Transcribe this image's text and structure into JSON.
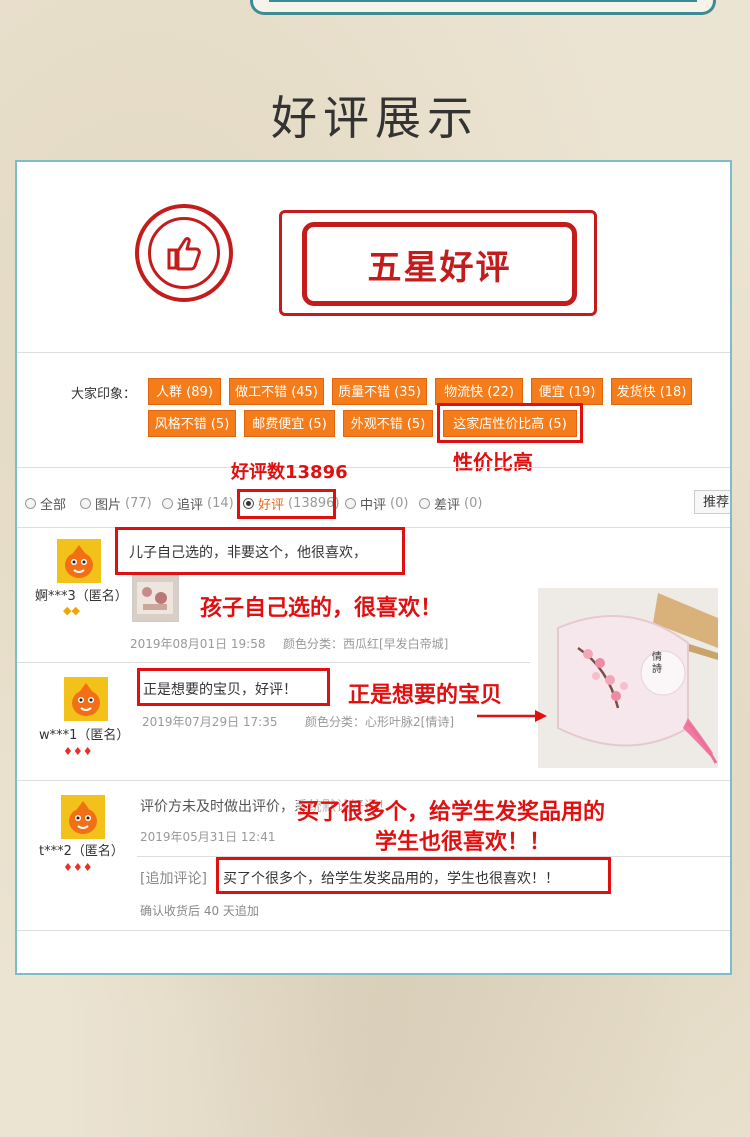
{
  "page_title": "好评展示",
  "stamp_text": "五星好评",
  "impressions": {
    "label": "大家印象：",
    "tags": [
      "人群 (89)",
      "做工不错 (45)",
      "质量不错 (35)",
      "物流快 (22)",
      "便宜 (19)",
      "发货快 (18)",
      "风格不错 (5)",
      "邮费便宜 (5)",
      "外观不错 (5)",
      "这家店性价比高 (5)"
    ]
  },
  "annotations": {
    "value_label": "性价比高",
    "good_count_label": "好评数13896",
    "review1": "孩子自己选的，很喜欢！",
    "review2": "正是想要的宝贝",
    "review3_line1": "买了很多个，给学生发奖品用的",
    "review3_line2": "学生也很喜欢！！"
  },
  "filters": [
    {
      "label": "全部",
      "count": ""
    },
    {
      "label": "图片",
      "count": "(77)"
    },
    {
      "label": "追评",
      "count": "(14)"
    },
    {
      "label": "好评",
      "count": "(13896)"
    },
    {
      "label": "中评",
      "count": "(0)"
    },
    {
      "label": "差评",
      "count": "(0)"
    }
  ],
  "sort_label": "推荐",
  "reviews": [
    {
      "user": "婀***3（匿名）",
      "comment": "儿子自己选的，非要这个，他很喜欢，",
      "date": "2019年08月01日 19:58",
      "variant": "颜色分类：西瓜红[早发白帝城]"
    },
    {
      "user": "w***1（匿名）",
      "comment": "正是想要的宝贝，好评！",
      "date": "2019年07月29日 17:35",
      "variant": "颜色分类：心形叶脉2[情诗]"
    },
    {
      "user": "t***2（匿名）",
      "comment": "评价方未及时做出评价，系统默认好评！",
      "date": "2019年05月31日 12:41",
      "followup_tag": "[追加评论]",
      "followup": "买了个很多个，给学生发奖品用的，学生也很喜欢！！",
      "followup_meta": "确认收货后 40 天追加"
    }
  ],
  "colors": {
    "accent_orange": "#f57c1a",
    "stamp_red": "#c41b1b",
    "annotation_red": "#e01010",
    "frame_teal": "#7fbcc9"
  }
}
